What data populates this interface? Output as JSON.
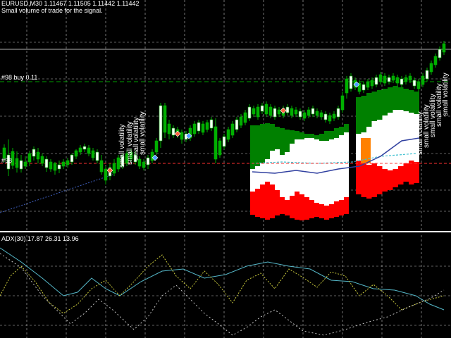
{
  "header": {
    "symbol_line": "EURUSD,M30  1.11467 1.11505 1.11442 1.11442",
    "signal_text": "Small volume of trade for the signal."
  },
  "order": {
    "label": "#98 buy 0.11",
    "short_label": "#98"
  },
  "indicator": {
    "label": "ADX(30) 17.87 26.31 13.96"
  },
  "annotations": {
    "volatility_text": "small volatility"
  },
  "colors": {
    "background": "#000000",
    "grid": "#c0c0c0",
    "candle_up": "#00b000",
    "candle_down": "#ffffff",
    "green_band": "#008000",
    "white_band": "#ffffff",
    "red_band": "#ff0000",
    "orange": "#ff8000",
    "adx_main": "#55b7c8",
    "adx_plus": "#c8c83c",
    "adx_minus": "#c0c0c0",
    "buy_line": "#00a000",
    "sl_line": "#ff3030"
  }
}
